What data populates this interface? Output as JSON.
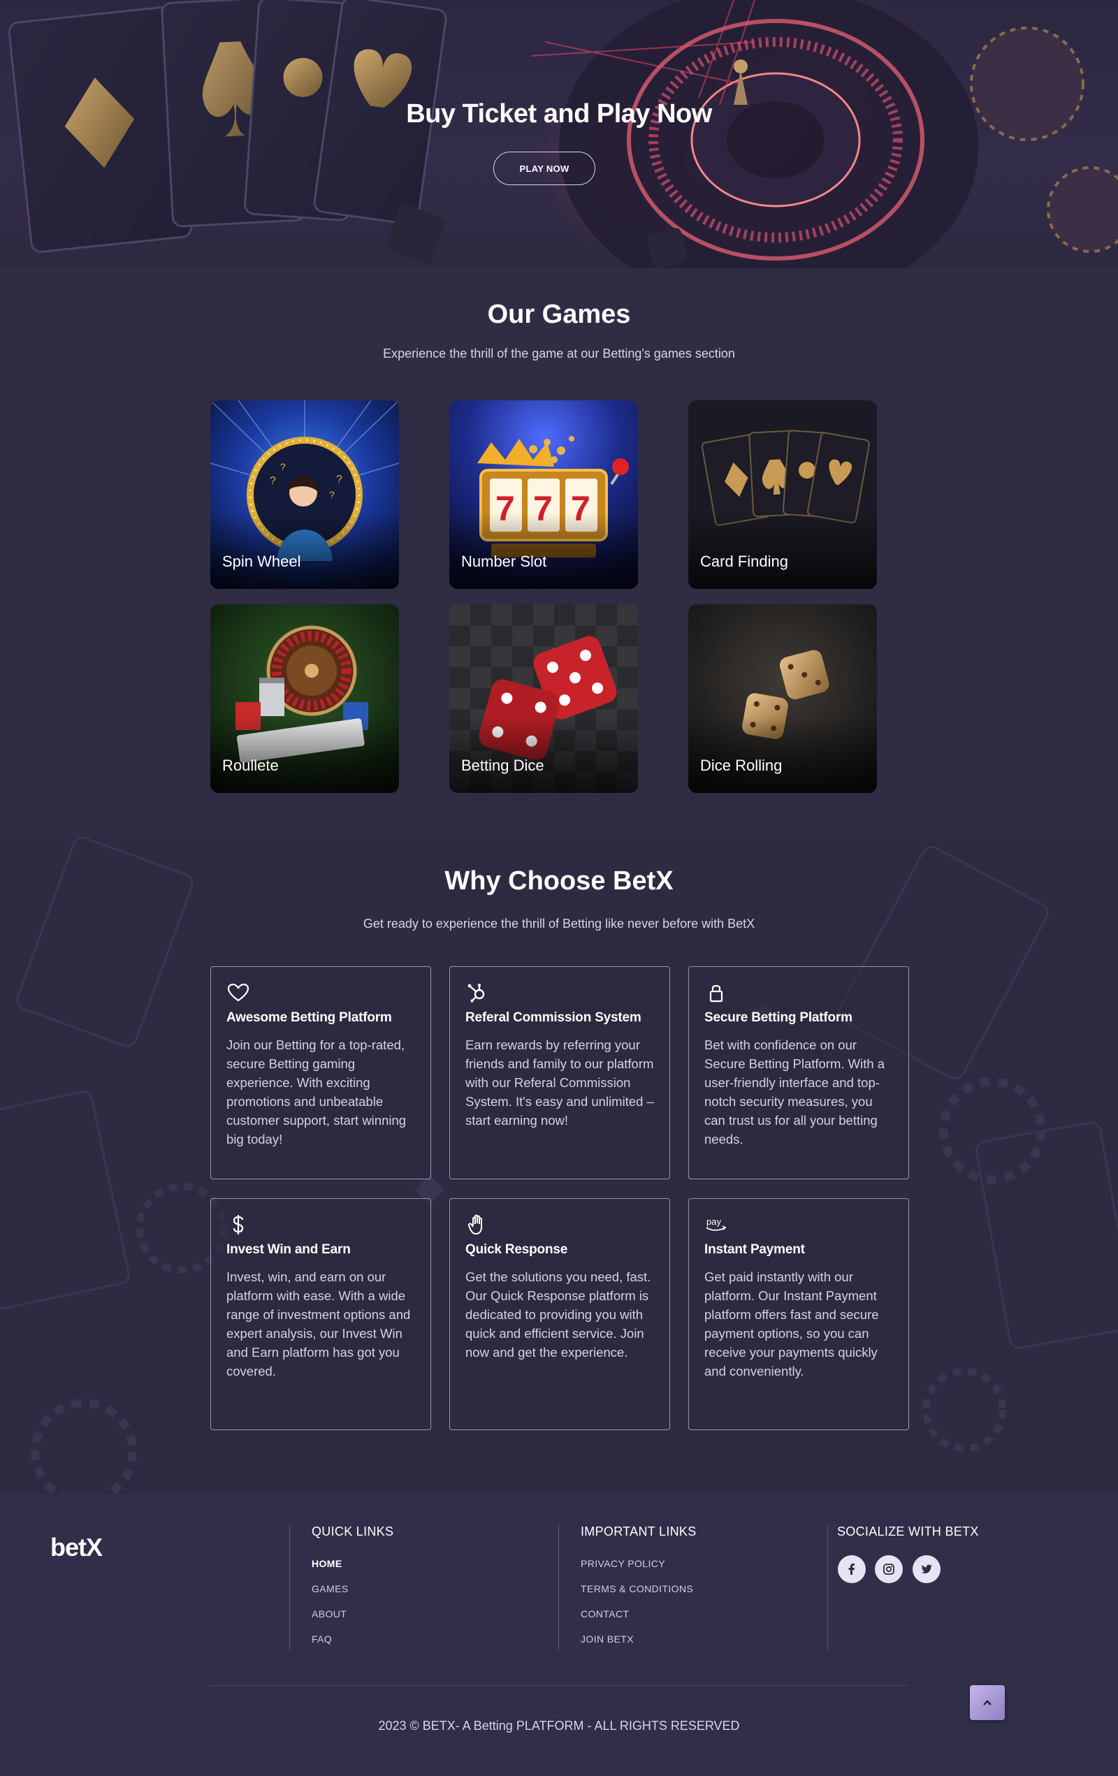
{
  "hero": {
    "title": "Buy Ticket and Play Now",
    "cta_label": "PLAY NOW"
  },
  "games": {
    "title": "Our Games",
    "subtitle": "Experience the thrill of the game at our Betting's games section",
    "items": [
      {
        "label": "Spin Wheel"
      },
      {
        "label": "Number Slot"
      },
      {
        "label": "Card Finding"
      },
      {
        "label": "Roullete"
      },
      {
        "label": "Betting Dice"
      },
      {
        "label": "Dice Rolling"
      }
    ]
  },
  "why": {
    "title": "Why Choose BetX",
    "subtitle": "Get ready to experience the thrill of Betting like never before with BetX",
    "features": [
      {
        "icon": "heart-icon",
        "title": "Awesome Betting Platform",
        "desc": "Join our Betting for a top-rated, secure Betting gaming experience. With exciting promotions and unbeatable customer support, start winning big today!"
      },
      {
        "icon": "hubspot-icon",
        "title": "Referal Commission System",
        "desc": "Earn rewards by referring your friends and family to our platform with our Referal Commission System. It's easy and unlimited – start earning now!"
      },
      {
        "icon": "lock-icon",
        "title": "Secure Betting Platform",
        "desc": "Bet with confidence on our Secure Betting Platform. With a user-friendly interface and top-notch security measures, you can trust us for all your betting needs."
      },
      {
        "icon": "dollar-icon",
        "title": "Invest Win and Earn",
        "desc": "Invest, win, and earn on our platform with ease. With a wide range of investment options and expert analysis, our Invest Win and Earn platform has got you covered."
      },
      {
        "icon": "hand-icon",
        "title": "Quick Response",
        "desc": "Get the solutions you need, fast. Our Quick Response platform is dedicated to providing you with quick and efficient service. Join now and get the experience."
      },
      {
        "icon": "amazon-pay-icon",
        "title": "Instant Payment",
        "desc": "Get paid instantly with our platform. Our Instant Payment platform offers fast and secure payment options, so you can receive your payments quickly and conveniently."
      }
    ]
  },
  "footer": {
    "logo": "betX",
    "quick_links": {
      "title": "QUICK LINKS",
      "items": [
        "HOME",
        "GAMES",
        "ABOUT",
        "FAQ"
      ]
    },
    "important_links": {
      "title": "IMPORTANT LINKS",
      "items": [
        "PRIVACY POLICY",
        "TERMS & CONDITIONS",
        "CONTACT",
        "JOIN BETX"
      ]
    },
    "social": {
      "title": "SOCIALIZE WITH BETX",
      "icons": [
        "facebook-icon",
        "instagram-icon",
        "twitter-icon"
      ]
    },
    "copyright": "2023 © BETX- A Betting PLATFORM - ALL RIGHTS RESERVED"
  },
  "colors": {
    "background": "#2e2b43",
    "footer": "#312e49",
    "card_border": "#9a95b3",
    "accent_red": "#d63c5a"
  }
}
